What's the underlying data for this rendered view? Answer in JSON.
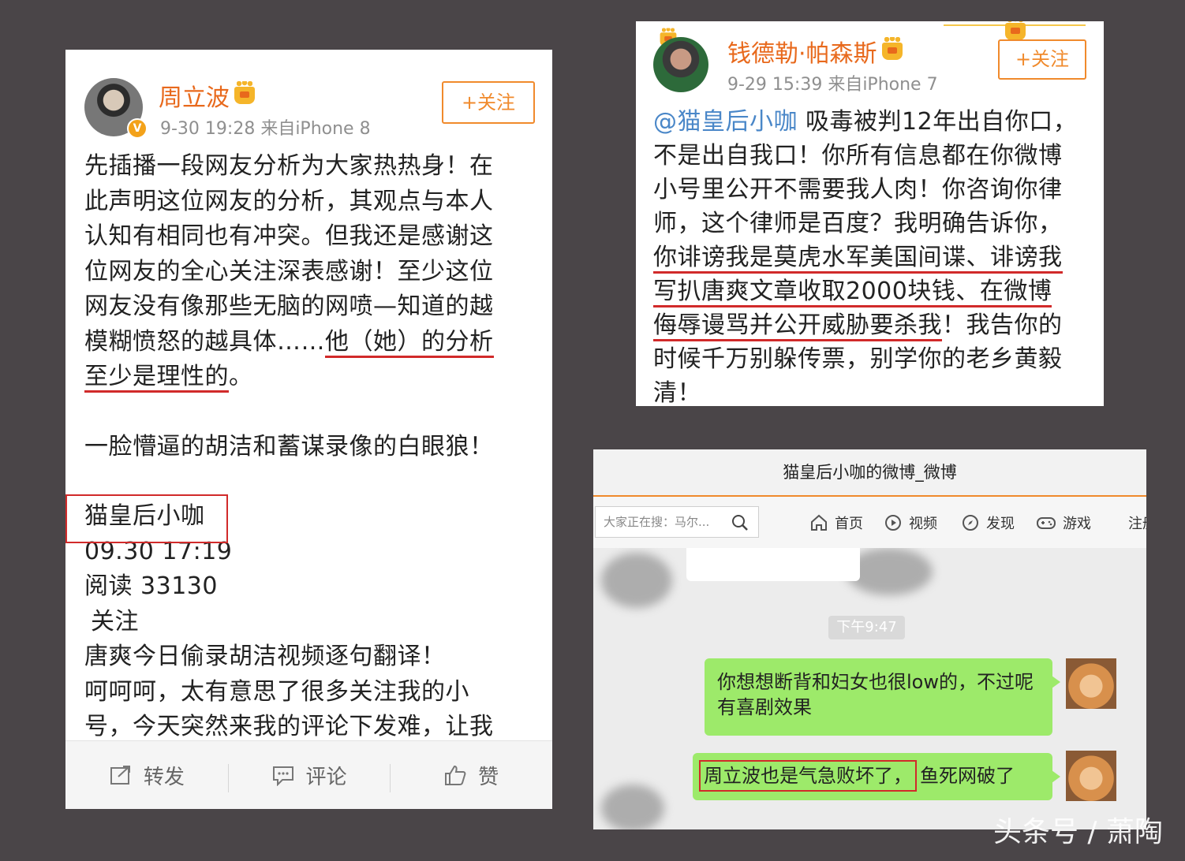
{
  "left_post": {
    "author": "周立波",
    "meta": "9-30 19:28 来自iPhone 8",
    "follow_label": "+关注",
    "body_lines": [
      "先插播一段网友分析为大家热热身！在",
      "此声明这位网友的分析，其观点与本人",
      "认知有相同也有冲突。但我还是感谢这",
      "位网友的全心关注深表感谢！至少这位",
      "网友没有像那些无脑的网喷—知道的越"
    ],
    "line6_a": "模糊愤怒的越具体……",
    "line6_b": "他（她）的分析",
    "line7_a": "至少是理性的",
    "line7_b": "。",
    "line8": "一脸懵逼的胡洁和蓄谋录像的白眼狼！",
    "quoted_name": "猫皇后小咖",
    "quoted_time": "09.30 17:19",
    "quoted_reads": "阅读 33130",
    "quoted_follow": "关注",
    "quoted_line1": "唐爽今日偷录胡洁视频逐句翻译！",
    "quoted_line2": "呵呵呵，太有意思了很多关注我的小",
    "quoted_line3": "号，今天突然来我的评论下发难，让我",
    "actions": {
      "repost": "转发",
      "comment": "评论",
      "like": "赞"
    }
  },
  "right_post": {
    "author": "钱德勒·帕森斯",
    "meta": "9-29 15:39 来自iPhone 7",
    "follow_label": "+关注",
    "mention": "@猫皇后小咖",
    "line1_rest": " 吸毒被判12年出自你口，",
    "line2": "不是出自我口！你所有信息都在你微博",
    "line3": "小号里公开不需要我人肉！你咨询你律",
    "line4": "师，这个律师是百度？我明确告诉你，",
    "line5": "你诽谤我是莫虎水军美国间谍、诽谤我",
    "line6": "写扒唐爽文章收取2000块钱、在微博",
    "line7_a": "侮辱谩骂并公开威胁要杀我",
    "line7_b": "！我告你的",
    "line8": "时候千万别躲传票，别学你的老乡黄毅",
    "line9": "清！"
  },
  "chat_window": {
    "title": "猫皇后小咖的微博_微博",
    "search_placeholder": "大家正在搜：马尔...",
    "nav": [
      "首页",
      "视频",
      "发现",
      "游戏",
      "注册"
    ],
    "time_chip": "下午9:47",
    "msg1": "你想想断背和妇女也很low的，不过呢有喜剧效果",
    "msg2_a": "周立波也是气急败坏了，",
    "msg2_b": "鱼死网破了"
  },
  "watermark": "头条号 / 萧陶",
  "colors": {
    "accent": "#f08a2c",
    "name": "#e8691c",
    "underline": "#d12a2a",
    "bubble": "#9dea6a",
    "mention": "#4a87c8"
  }
}
